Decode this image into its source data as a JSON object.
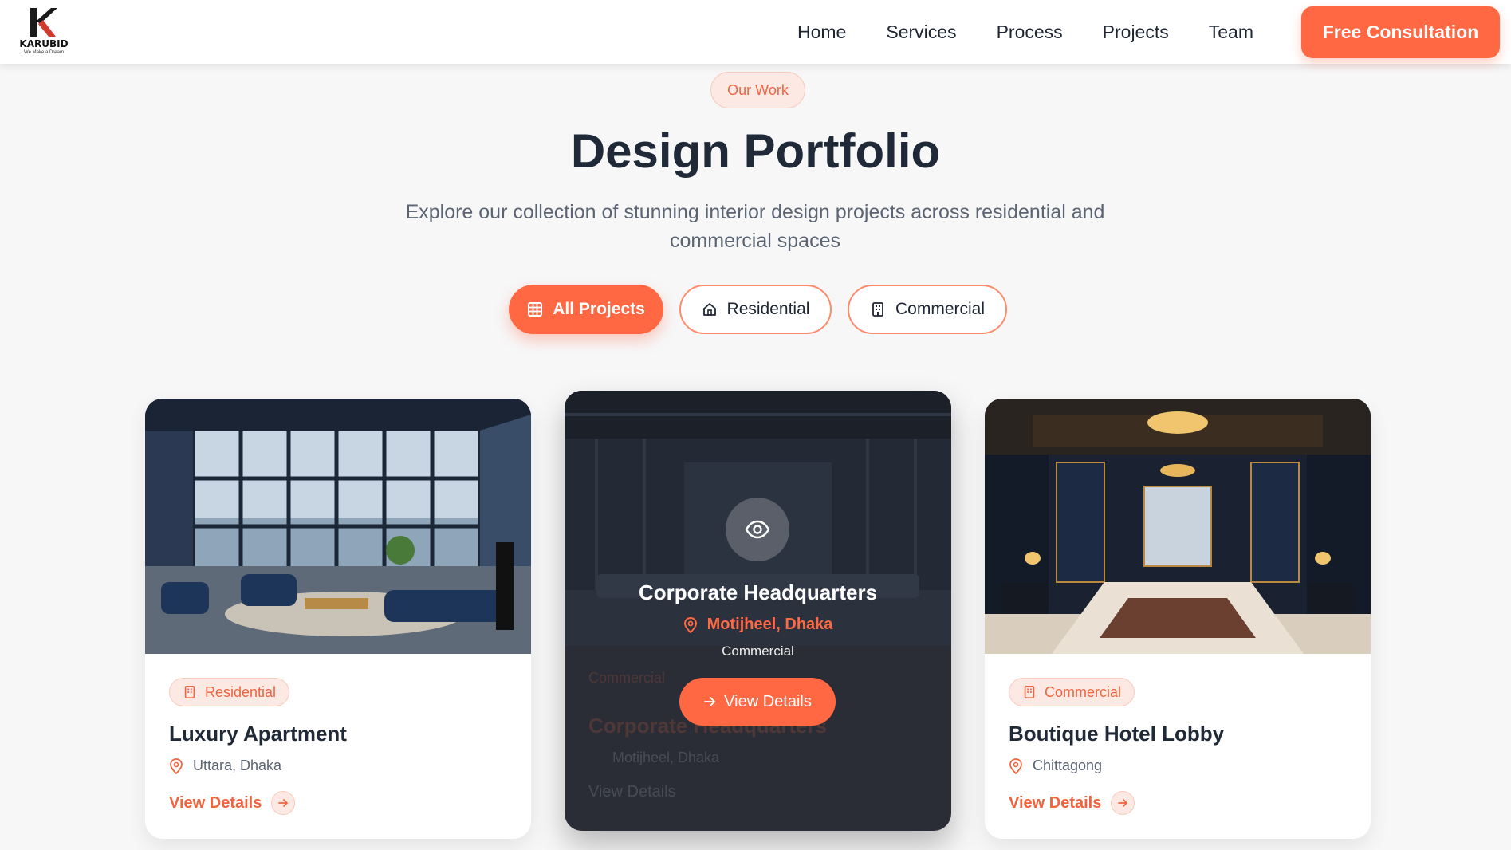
{
  "header": {
    "logo_text": "KARUBID",
    "logo_tagline": "We Make a Dream",
    "nav": [
      "Home",
      "Services",
      "Process",
      "Projects",
      "Team"
    ],
    "cta_label": "Free Consultation"
  },
  "section": {
    "pill": "Our Work",
    "title": "Design Portfolio",
    "subtitle": "Explore our collection of stunning interior design projects across residential and commercial spaces"
  },
  "filters": {
    "all": "All Projects",
    "residential": "Residential",
    "commercial": "Commercial"
  },
  "projects": [
    {
      "category": "Residential",
      "title": "Luxury Apartment",
      "location": "Uttara, Dhaka",
      "link": "View Details",
      "image_icon": "apartment-photo"
    },
    {
      "category": "Commercial",
      "title": "Corporate Headquarters",
      "location": "Motijheel, Dhaka",
      "link": "View Details",
      "image_icon": "office-photo"
    },
    {
      "category": "Commercial",
      "title": "Boutique Hotel Lobby",
      "location": "Chittagong",
      "link": "View Details",
      "image_icon": "hotel-lobby-photo"
    }
  ],
  "colors": {
    "accent": "#ff6843",
    "dark": "#1f2937",
    "muted": "#5b6472"
  }
}
